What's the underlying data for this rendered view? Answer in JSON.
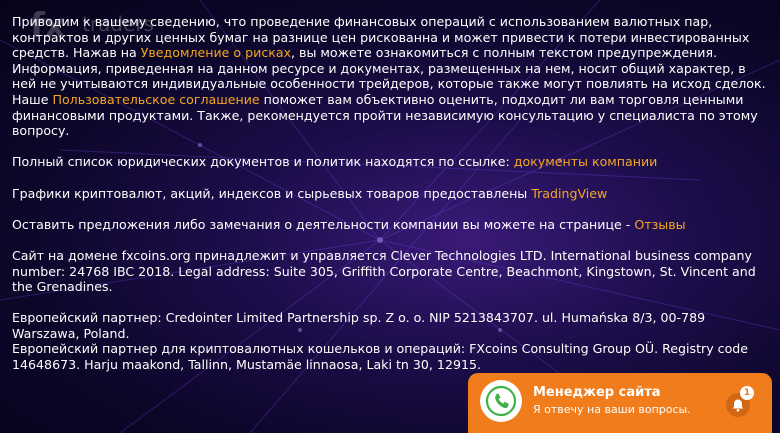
{
  "watermark": {
    "brand_fx": "fx",
    "brand_word": "traders"
  },
  "disclaimer": {
    "text_before": "Приводим к вашему сведению, что проведение финансовых операций с использованием валютных пар, контрактов и других ценных бумаг на разнице цен рискованна и может привести к потери инвестированных средств. Нажав на ",
    "risk_link": "Уведомление о рисках",
    "text_after": ", вы можете ознакомиться с полным текстом предупреждения. Информация, приведенная на данном ресурсе и документах, размещенных на нем, носит общий характер, в ней не учитываются индивидуальные особенности трейдеров, которые также могут повлиять на исход сделок."
  },
  "agreement": {
    "text_before": "Наше ",
    "link": "Пользовательское соглашение",
    "text_after": " поможет вам объективно оценить, подходит ли вам торговля ценными финансовыми продуктами. Также, рекомендуется пройти независимую консультацию у специалиста по этому вопросу."
  },
  "documents": {
    "text": "Полный список юридических документов и политик находятся по ссылке: ",
    "link": "документы компании"
  },
  "charts": {
    "text": "Графики криптовалют, акций, индексов и сырьевых товаров предоставлены ",
    "link": "TradingView"
  },
  "feedback": {
    "text": "Оставить предложения либо замечания о деятельности компании вы можете на странице - ",
    "link": "Отзывы"
  },
  "domain_info": "Сайт на домене fxcoins.org принадлежит и управляется Clever Technologies LTD. International business company number: 24768 IBC 2018. Legal address: Suite 305, Griffith Corporate Centre, Beachmont, Kingstown, St. Vincent and the Grenadines.",
  "partner1": "Европейский партнер: Credointer Limited Partnership sp. Z o. o. NIP 5213843707. ul. Humańska 8/3, 00-789 Warszawa, Poland.",
  "partner2": "Европейский партнер для криптовалютных кошельков и операций: FXcoins Consulting Group OÜ. Registry code 14648673. Harju maakond, Tallinn, Mustamäe linnaosa, Laki tn 30, 12915.",
  "chat": {
    "title": "Менеджер сайта",
    "subtitle": "Я отвечу на ваши вопросы.",
    "badge_count": "1",
    "accent_color": "#f07c1c",
    "icons": {
      "avatar": "phone-icon",
      "bell": "bell-icon"
    }
  },
  "colors": {
    "link": "#f5a623",
    "text": "#ffffff"
  }
}
